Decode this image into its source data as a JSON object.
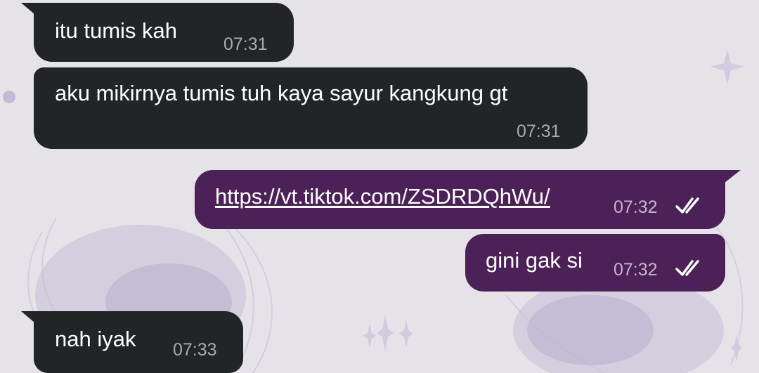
{
  "colors": {
    "incoming_bubble": "#212528",
    "outgoing_bubble": "#4c2157",
    "background": "#e6e3e8",
    "text": "#ffffff"
  },
  "messages": [
    {
      "direction": "incoming",
      "text": "itu tumis kah",
      "time": "07:31"
    },
    {
      "direction": "incoming",
      "text": "aku mikirnya tumis tuh kaya sayur kangkung gt",
      "time": "07:31"
    },
    {
      "direction": "outgoing",
      "text": "https://vt.tiktok.com/ZSDRDQhWu/",
      "time": "07:32",
      "is_link": true,
      "status": "read",
      "status_icon": "double-check-icon"
    },
    {
      "direction": "outgoing",
      "text": "gini gak si",
      "time": "07:32",
      "status": "read",
      "status_icon": "double-check-icon"
    },
    {
      "direction": "incoming",
      "text": "nah iyak",
      "time": "07:33"
    }
  ]
}
